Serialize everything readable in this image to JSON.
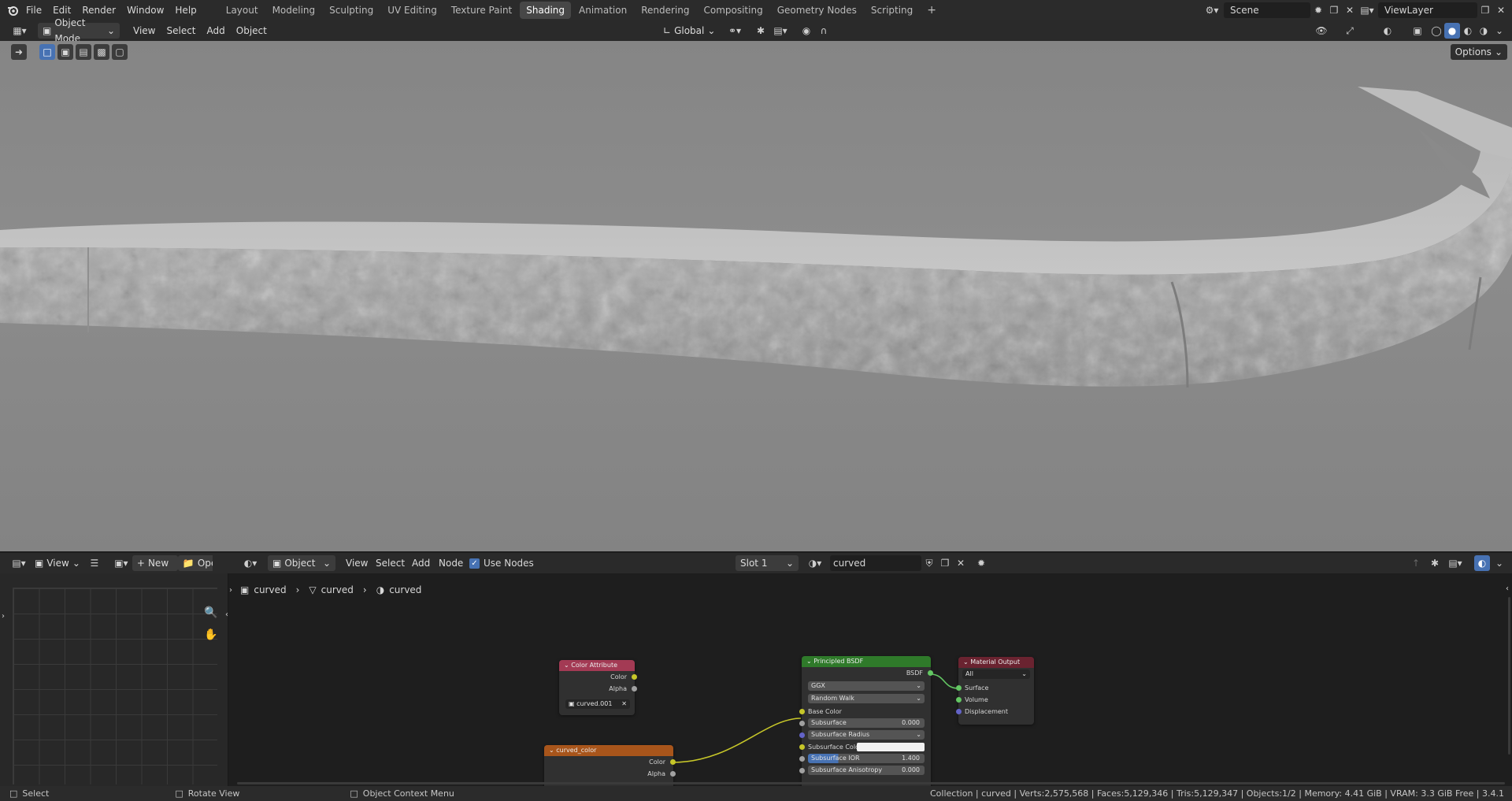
{
  "menubar": {
    "items": [
      "File",
      "Edit",
      "Render",
      "Window",
      "Help"
    ],
    "workspaces": [
      "Layout",
      "Modeling",
      "Sculpting",
      "UV Editing",
      "Texture Paint",
      "Shading",
      "Animation",
      "Rendering",
      "Compositing",
      "Geometry Nodes",
      "Scripting"
    ],
    "active_workspace": "Shading",
    "add_tab": "+",
    "scene": "Scene",
    "view_layer": "ViewLayer"
  },
  "viewport_header": {
    "mode": "Object Mode",
    "menus": [
      "View",
      "Select",
      "Add",
      "Object"
    ],
    "orientation": "Global",
    "options": "Options"
  },
  "node_header": {
    "view": "View",
    "new_button": "New",
    "open_button": "Open",
    "object_select": "Object",
    "menus": [
      "View",
      "Select",
      "Add",
      "Node"
    ],
    "use_nodes_label": "Use Nodes",
    "use_nodes_checked": true,
    "slot": "Slot 1",
    "material": "curved"
  },
  "breadcrumb": [
    "curved",
    "curved",
    "curved"
  ],
  "nodes": {
    "color_attribute": {
      "title": "Color Attribute",
      "outputs": [
        "Color",
        "Alpha"
      ],
      "attribute": "curved.001"
    },
    "curved_color": {
      "title": "curved_color",
      "outputs": [
        "Color",
        "Alpha"
      ]
    },
    "principled": {
      "title": "Principled BSDF",
      "output": "BSDF",
      "distribution": "GGX",
      "subsurface_method": "Random Walk",
      "inputs": [
        {
          "label": "Base Color",
          "value": ""
        },
        {
          "label": "Subsurface",
          "value": "0.000"
        },
        {
          "label": "Subsurface Radius",
          "value": ""
        },
        {
          "label": "Subsurface Color",
          "value": ""
        },
        {
          "label": "Subsurface IOR",
          "value": "1.400"
        },
        {
          "label": "Subsurface Anisotropy",
          "value": "0.000"
        }
      ]
    },
    "material_output": {
      "title": "Material Output",
      "target": "All",
      "inputs": [
        "Surface",
        "Volume",
        "Displacement"
      ]
    }
  },
  "statusbar": {
    "select": "Select",
    "rotate": "Rotate View",
    "context": "Object Context Menu",
    "stats": "Collection | curved | Verts:2,575,568 | Faces:5,129,346 | Tris:5,129,347 | Objects:1/2 | Memory: 4.41 GiB | VRAM: 3.3 GiB Free | 3.4.1"
  },
  "colors": {
    "node_color_attr": "#a33a54",
    "node_curved_color": "#a8551b",
    "node_principled": "#2f7a2a",
    "node_output": "#6a2330",
    "socket_yellow": "#c7c729",
    "socket_green": "#63c763",
    "socket_purple": "#6363c7",
    "socket_gray": "#a1a1a1"
  }
}
